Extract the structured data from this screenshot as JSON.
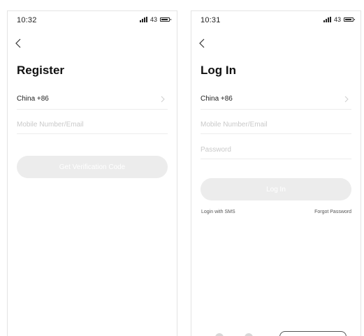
{
  "register": {
    "status_time": "10:32",
    "status_signal": "43",
    "title": "Register",
    "country": "China +86",
    "account_placeholder": "Mobile Number/Email",
    "submit_label": "Get Verification Code"
  },
  "login": {
    "status_time": "10:31",
    "status_signal": "43",
    "title": "Log In",
    "country": "China +86",
    "account_placeholder": "Mobile Number/Email",
    "password_placeholder": "Password",
    "submit_label": "Log In",
    "sms_link": "Login with SMS",
    "forgot_link": "Forgot Password"
  },
  "icons": [
    "back-icon",
    "chevron-right-icon",
    "signal-icon",
    "battery-icon"
  ],
  "colors": {
    "button_disabled": "#ececec",
    "placeholder": "#c9c9c9",
    "divider": "#ececec"
  }
}
